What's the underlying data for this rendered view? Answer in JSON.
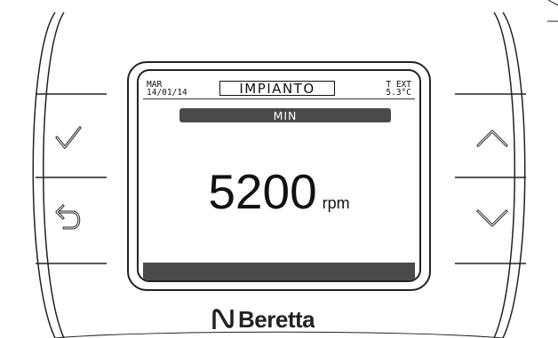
{
  "lcd": {
    "day": "MAR",
    "date": "14/01/14",
    "title": "IMPIANTO",
    "text_label": "T EXT",
    "text_value": "5.3°C",
    "submenu": "MIN",
    "value": "5200",
    "unit": "rpm"
  },
  "buttons": {
    "left_top": "checkmark-icon",
    "left_bottom": "back-icon",
    "right_top": "chevron-up-icon",
    "right_bottom": "chevron-down-icon"
  },
  "brand": {
    "name": "Beretta"
  }
}
